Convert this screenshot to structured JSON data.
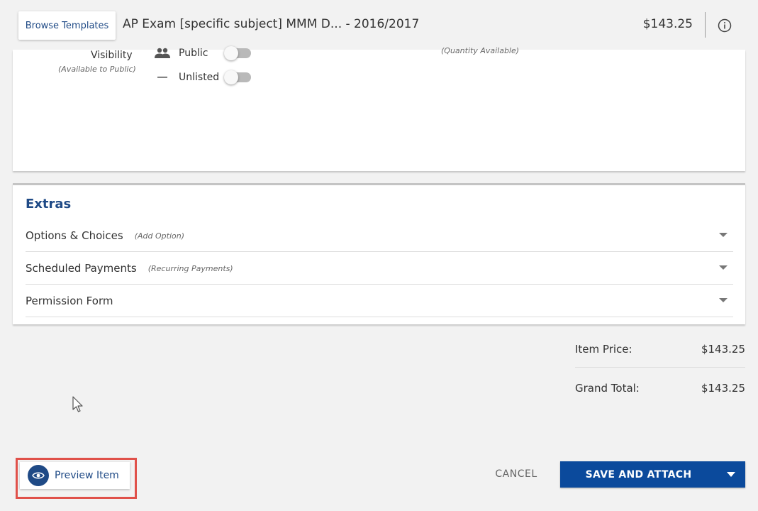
{
  "header": {
    "browse_templates_label": "Browse Templates",
    "title": "AP Exam [specific subject] MMM D...  - 2016/2017",
    "price": "$143.25",
    "info_icon": "info-icon"
  },
  "visibility": {
    "label": "Visibility",
    "sublabel": "(Available to Public)",
    "quantity_hint": "(Quantity Available)",
    "options": [
      {
        "label": "Public",
        "icon": "people-icon",
        "enabled": false
      },
      {
        "label": "Unlisted",
        "icon": "dash-icon",
        "enabled": false
      }
    ]
  },
  "extras": {
    "title": "Extras",
    "rows": [
      {
        "name": "Options & Choices",
        "hint": "(Add Option)"
      },
      {
        "name": "Scheduled Payments",
        "hint": "(Recurring Payments)"
      },
      {
        "name": "Permission Form",
        "hint": ""
      }
    ]
  },
  "totals": {
    "item_price_label": "Item Price:",
    "item_price_value": "$143.25",
    "grand_total_label": "Grand Total:",
    "grand_total_value": "$143.25"
  },
  "footer": {
    "preview_label": "Preview Item",
    "cancel_label": "CANCEL",
    "save_label": "SAVE AND ATTACH"
  },
  "colors": {
    "brand_blue": "#0b4a9c",
    "link_blue": "#1f4a86",
    "highlight_red": "#e0514a"
  }
}
